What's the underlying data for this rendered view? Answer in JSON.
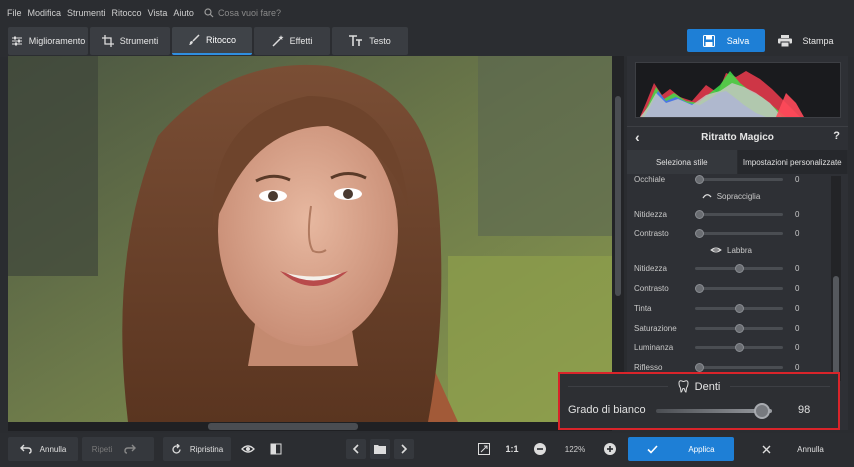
{
  "menu": {
    "items": [
      "File",
      "Modifica",
      "Strumenti",
      "Ritocco",
      "Vista",
      "Aiuto"
    ],
    "search_placeholder": "Cosa vuoi fare?"
  },
  "tabs": {
    "miglioramento": "Miglioramento",
    "strumenti": "Strumenti",
    "ritocco": "Ritocco",
    "effetti": "Effetti",
    "testo": "Testo",
    "active": "Ritocco"
  },
  "actions": {
    "save": "Salva",
    "print": "Stampa"
  },
  "panel": {
    "title": "Ritratto Magico",
    "help": "?",
    "subtabs": [
      "Seleziona stile",
      "Impostazioni personalizzate"
    ],
    "active_subtab": "Impostazioni personalizzate",
    "rows": {
      "occhiale": {
        "label": "Occhiale",
        "value": "0",
        "level": 0.0
      },
      "sect_sopracciglia": "Sopracciglia",
      "nitidezza1": {
        "label": "Nitidezza",
        "value": "0",
        "level": 0.0
      },
      "contrasto1": {
        "label": "Contrasto",
        "value": "0",
        "level": 0.0
      },
      "sect_labbra": "Labbra",
      "nitidezza2": {
        "label": "Nitidezza",
        "value": "0",
        "level": 0.5
      },
      "contrasto2": {
        "label": "Contrasto",
        "value": "0",
        "level": 0.0
      },
      "tinta": {
        "label": "Tinta",
        "value": "0",
        "level": 0.5
      },
      "saturazione": {
        "label": "Saturazione",
        "value": "0",
        "level": 0.5
      },
      "luminanza": {
        "label": "Luminanza",
        "value": "0",
        "level": 0.5
      },
      "riflesso": {
        "label": "Riflesso",
        "value": "0",
        "level": 0.0
      }
    }
  },
  "zoom_panel": {
    "section": "Denti",
    "label": "Grado di bianco",
    "value": "98",
    "level": 0.98
  },
  "bottom": {
    "undo": "Annulla",
    "redo": "Ripeti",
    "reset": "Ripristina",
    "one_to_one": "1:1",
    "zoom": "122%",
    "apply": "Applica",
    "cancel": "Annulla"
  }
}
